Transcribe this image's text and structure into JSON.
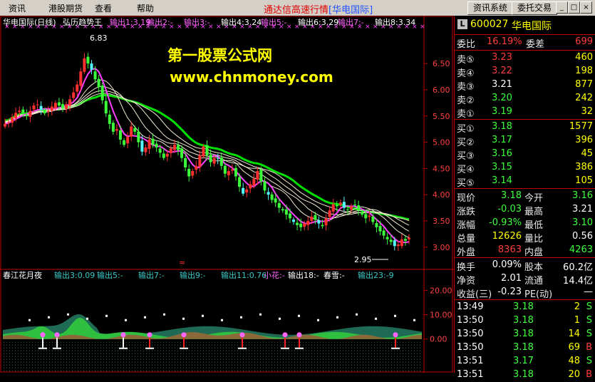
{
  "menu": [
    "资讯",
    "港股期货",
    "查看",
    "帮助"
  ],
  "app_title": "通达信高速行情",
  "app_title_tag": "[华电国际]",
  "toolbar": {
    "btn1": "资讯系统",
    "btn2": "委托交易"
  },
  "window_buttons": {
    "minimize": "_",
    "restore": "□",
    "close": "×"
  },
  "watermark": {
    "line1": "第一股票公式网",
    "line2": "www.chnmoney.com"
  },
  "main_legend": [
    {
      "text": "华电国际(日线)",
      "color": "#ffffff"
    },
    {
      "text": "弘历趋势王",
      "color": "#ffffff"
    },
    {
      "text": "输出1:3.19",
      "color": "#ff66ff"
    },
    {
      "text": "输出2:-",
      "color": "#ff66ff"
    },
    {
      "text": "输出3:-",
      "color": "#ff66ff"
    },
    {
      "text": "输出4:3.24",
      "color": "#ffffff"
    },
    {
      "text": "输出5:-",
      "color": "#ff66ff"
    },
    {
      "text": "输出6:3.29",
      "color": "#ffffff"
    },
    {
      "text": "输出7:-",
      "color": "#ff66ff"
    },
    {
      "text": "输出8:3.34",
      "color": "#ffffff"
    }
  ],
  "sub_legend": [
    {
      "text": "春江花月夜",
      "color": "#ffffff"
    },
    {
      "text": "输出3:0.09",
      "color": "#3cc8c8"
    },
    {
      "text": "输出5:-",
      "color": "#3cc8c8"
    },
    {
      "text": "输出7:-",
      "color": "#3cc8c8"
    },
    {
      "text": "输出9:-",
      "color": "#3cc8c8"
    },
    {
      "text": "输出11:0.76",
      "color": "#3cc8c8"
    },
    {
      "text": "小花:-",
      "color": "#ff66ff"
    },
    {
      "text": "输出18:-",
      "color": "#ffffff"
    },
    {
      "text": "春雪:-",
      "color": "#ffffff"
    },
    {
      "text": "输出23:-9",
      "color": "#3cc8c8"
    }
  ],
  "colors": {
    "up": "#ff3030",
    "down": "#3cff3c",
    "cyan": "#54fcfc",
    "frame": "#c00000",
    "ma_dark": "#00c000"
  },
  "chart_data": {
    "type": "candlestick",
    "title": "华电国际(日线)",
    "y_ticks": [
      "6.50",
      "6.00",
      "5.50",
      "5.00",
      "4.50",
      "4.00",
      "3.50",
      "3.00"
    ],
    "y_min": 2.82,
    "y_max": 7.1,
    "annotations": {
      "high": "6.83",
      "low": "2.95"
    },
    "close": [
      5.35,
      5.38,
      5.48,
      5.56,
      5.6,
      5.55,
      5.5,
      5.6,
      5.7,
      5.72,
      5.62,
      5.55,
      5.6,
      5.68,
      5.75,
      5.7,
      5.65,
      5.72,
      5.82,
      5.95,
      6.1,
      6.35,
      6.6,
      6.5,
      6.38,
      6.2,
      6.05,
      5.8,
      5.55,
      5.35,
      5.2,
      5.25,
      5.05,
      4.95,
      5.1,
      5.3,
      5.2,
      5.0,
      4.82,
      4.9,
      5.05,
      4.95,
      4.9,
      4.8,
      4.7,
      4.78,
      4.88,
      4.95,
      4.85,
      4.7,
      4.52,
      4.35,
      4.45,
      4.55,
      4.75,
      4.92,
      4.75,
      4.62,
      4.7,
      4.68,
      4.55,
      4.4,
      4.45,
      4.48,
      4.35,
      4.15,
      4.02,
      4.1,
      4.2,
      4.3,
      4.45,
      4.25,
      4.08,
      4.0,
      3.9,
      3.85,
      3.75,
      3.7,
      3.62,
      3.55,
      3.48,
      3.42,
      3.38,
      3.45,
      3.5,
      3.58,
      3.52,
      3.45,
      3.4,
      3.55,
      3.7,
      3.82,
      3.78,
      3.85,
      3.75,
      3.72,
      3.78,
      3.8,
      3.7,
      3.62,
      3.55,
      3.6,
      3.48,
      3.38,
      3.3,
      3.22,
      3.15,
      3.1,
      3.02,
      3.05,
      3.15,
      3.12,
      3.18
    ],
    "sub_panel": {
      "y_ticks": [
        "20.00",
        "10.00",
        "0.00"
      ],
      "y_min": -13,
      "y_max": 24
    }
  },
  "stock": {
    "code": "600027",
    "name": "华电国际",
    "badge": "L"
  },
  "quote": {
    "weibi_label": "委比",
    "weibi": "16.19%",
    "weicha_label": "委差",
    "weicha": "699",
    "asks": [
      {
        "label": "卖⑤",
        "price": "3.23",
        "vol": "460",
        "pc": "red"
      },
      {
        "label": "卖④",
        "price": "3.22",
        "vol": "198",
        "pc": "red"
      },
      {
        "label": "卖③",
        "price": "3.21",
        "vol": "877",
        "pc": "wht"
      },
      {
        "label": "卖②",
        "price": "3.20",
        "vol": "242",
        "pc": "grn"
      },
      {
        "label": "卖①",
        "price": "3.19",
        "vol": "32",
        "pc": "grn"
      }
    ],
    "bids": [
      {
        "label": "买①",
        "price": "3.18",
        "vol": "1577",
        "pc": "grn"
      },
      {
        "label": "买②",
        "price": "3.17",
        "vol": "396",
        "pc": "grn"
      },
      {
        "label": "买③",
        "price": "3.16",
        "vol": "45",
        "pc": "grn"
      },
      {
        "label": "买④",
        "price": "3.15",
        "vol": "386",
        "pc": "grn"
      },
      {
        "label": "买⑤",
        "price": "3.14",
        "vol": "105",
        "pc": "grn"
      }
    ],
    "stats": [
      {
        "l1": "现价",
        "v1": "3.18",
        "c1": "grn",
        "l2": "今开",
        "v2": "3.16",
        "c2": "grn"
      },
      {
        "l1": "涨跌",
        "v1": "-0.03",
        "c1": "grn",
        "l2": "最高",
        "v2": "3.21",
        "c2": "wht"
      },
      {
        "l1": "涨幅",
        "v1": "-0.93%",
        "c1": "grn",
        "l2": "最低",
        "v2": "3.10",
        "c2": "grn"
      },
      {
        "l1": "总量",
        "v1": "12626",
        "c1": "yel",
        "l2": "量比",
        "v2": "0.56",
        "c2": "wht"
      },
      {
        "l1": "外盘",
        "v1": "8363",
        "c1": "red",
        "l2": "内盘",
        "v2": "4263",
        "c2": "grn"
      }
    ],
    "stats2": [
      {
        "l1": "换手",
        "v1": "0.09%",
        "c1": "wht",
        "l2": "股本",
        "v2": "60.2亿",
        "c2": "wht"
      },
      {
        "l1": "净资",
        "v1": "2.01",
        "c1": "wht",
        "l2": "流通",
        "v2": "14.4亿",
        "c2": "wht"
      },
      {
        "l1": "收益(三)",
        "v1": "-0.23",
        "c1": "wht",
        "l2": "PE(动)",
        "v2": "—",
        "c2": "wht"
      }
    ],
    "ticks": [
      {
        "time": "13:49",
        "price": "3.18",
        "vol": "2",
        "dir": "S",
        "dc": "grn"
      },
      {
        "time": "13:50",
        "price": "3.18",
        "vol": "1",
        "dir": "S",
        "dc": "grn"
      },
      {
        "time": "13:50",
        "price": "3.18",
        "vol": "14",
        "dir": "S",
        "dc": "grn"
      },
      {
        "time": "13:50",
        "price": "3.18",
        "vol": "69",
        "dir": "B",
        "dc": "red"
      },
      {
        "time": "13:51",
        "price": "3.17",
        "vol": "48",
        "dir": "S",
        "dc": "grn"
      },
      {
        "time": "13:51",
        "price": "3.18",
        "vol": "20",
        "dir": "B",
        "dc": "red"
      }
    ]
  }
}
